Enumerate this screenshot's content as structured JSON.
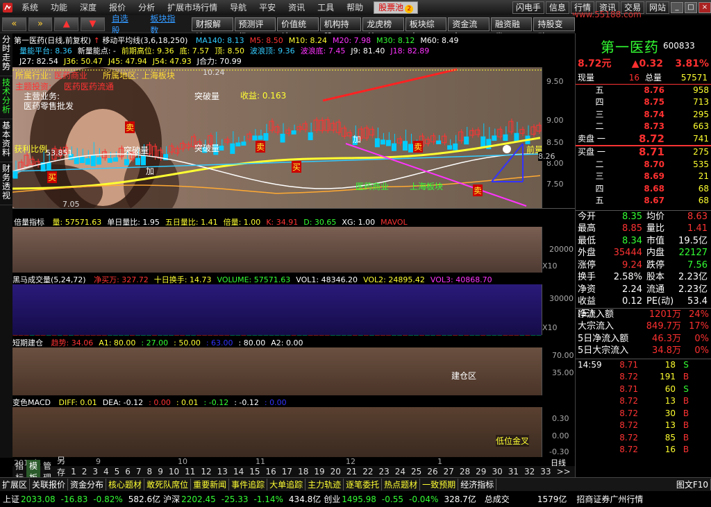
{
  "menu": {
    "items": [
      "系统",
      "功能",
      "深度",
      "报价",
      "分析",
      "扩展市场行情",
      "导航",
      "平安",
      "资讯",
      "工具",
      "帮助"
    ],
    "pool": "股票池",
    "right": [
      "闪电手",
      "信息",
      "行情",
      "资讯",
      "交易",
      "网站"
    ],
    "watermark": "www.55188.com"
  },
  "toolbar": {
    "links": [
      "自选股",
      "板块指数"
    ],
    "buttons": [
      "财报解读",
      "预测评级",
      "价值统计",
      "机构持股",
      "龙虎榜单",
      "板块综合",
      "资金流向",
      "融资融券",
      "持股变动"
    ]
  },
  "vtabs": [
    "分时走势",
    "技术分析",
    "基本资料",
    "财务透视"
  ],
  "main": {
    "title": "第一医药(日线,前复权)",
    "ma_title": "移动平均线(3,6,18,250)",
    "ma_vals": [
      {
        "t": "MA140: 8.13",
        "c": "#3cf"
      },
      {
        "t": "M5: 8.50",
        "c": "#f33"
      },
      {
        "t": "M10: 8.24",
        "c": "#ff3"
      },
      {
        "t": "M20: 7.98",
        "c": "#f3f"
      },
      {
        "t": "M30: 8.12",
        "c": "#3f3"
      },
      {
        "t": "M60: 8.49",
        "c": "#fff"
      }
    ],
    "l2": [
      {
        "t": "量能平台: 8.36",
        "c": "#3cf"
      },
      {
        "t": "新量能点: -",
        "c": "#fff"
      },
      {
        "t": "前期高位: 9.36",
        "c": "#ff3"
      },
      {
        "t": "底: 7.57",
        "c": "#ff3"
      },
      {
        "t": "顶: 8.50",
        "c": "#ff3"
      },
      {
        "t": "波浪顶: 9.36",
        "c": "#3cf"
      },
      {
        "t": "波浪底: 7.45",
        "c": "#f3f"
      },
      {
        "t": "J9: 81.40",
        "c": "#fff"
      },
      {
        "t": "J18: 82.89",
        "c": "#f3f"
      }
    ],
    "l3": [
      {
        "t": "J27: 82.54",
        "c": "#fff"
      },
      {
        "t": "J36: 50.47",
        "c": "#ff3"
      },
      {
        "t": "J45: 47.94",
        "c": "#ff3"
      },
      {
        "t": "J54: 47.93",
        "c": "#ff3"
      },
      {
        "t": "J合力: 70.99",
        "c": "#fff"
      }
    ],
    "overlay": {
      "gainian": "所属行业:",
      "hy": "医药商业",
      "region_label": "所属地区:",
      "region": "上海板块",
      "theme_label": "主题投资:",
      "theme": "医药医药流通",
      "business_label": "主营业务:",
      "business": "医药零售批发",
      "profit": "收益: 0.163",
      "ratio_label": "获利比例",
      "ratio_val": "53.851",
      "high": "10.24",
      "low": "7.05",
      "sector1": "医药商业",
      "sector2": "上海板块",
      "tupo": "突破量",
      "buy1": "买",
      "sell1": "卖",
      "add1": "加",
      "liangneng": "量能",
      "qianliang": "前量"
    },
    "price_ticks": [
      "9.50",
      "9.00",
      "8.50",
      "8.00",
      "7.50"
    ],
    "px_tick": "8.26",
    "vol_title": "倍量指标",
    "vol_vals": [
      {
        "t": "量: 57571.63",
        "c": "#ff3"
      },
      {
        "t": "单日量比: 1.95",
        "c": "#fff"
      },
      {
        "t": "五日量比: 1.41",
        "c": "#ff3"
      },
      {
        "t": "倍量: 1.00",
        "c": "#ff3"
      },
      {
        "t": "K: 34.91",
        "c": "#f33"
      },
      {
        "t": "D: 30.65",
        "c": "#3f3"
      },
      {
        "t": "XG: 1.00",
        "c": "#fff"
      },
      {
        "t": "MAVOL",
        "c": "#f33"
      }
    ],
    "vol_ticks": [
      "20000"
    ],
    "vol_unit": "X10",
    "hm_title": "黑马成交量(5,24,72)",
    "hm_vals": [
      {
        "t": "净买万: 327.72",
        "c": "#f33"
      },
      {
        "t": "十日换手: 14.73",
        "c": "#ff3"
      },
      {
        "t": "VOLUME: 57571.63",
        "c": "#3f3"
      },
      {
        "t": "VOL1: 48346.20",
        "c": "#fff"
      },
      {
        "t": "VOL2: 24895.42",
        "c": "#ff3"
      },
      {
        "t": "VOL3: 40868.70",
        "c": "#f3f"
      }
    ],
    "hm_ticks": [
      "30000"
    ],
    "hm_unit": "X10",
    "dq_title": "短期建仓",
    "dq_vals": [
      {
        "t": "趋势: 34.06",
        "c": "#f33"
      },
      {
        "t": "A1: 80.00",
        "c": "#ff3"
      },
      {
        "t": ": 27.00",
        "c": "#3f3"
      },
      {
        "t": ": 50.00",
        "c": "#ff3"
      },
      {
        "t": ": 63.00",
        "c": "#33f"
      },
      {
        "t": ": 80.00",
        "c": "#fff"
      },
      {
        "t": "A2: 0.00",
        "c": "#fff"
      }
    ],
    "dq_ticks": [
      "70.00",
      "35.00"
    ],
    "dq_label": "建仓区",
    "macd_title": "变色MACD",
    "macd_vals": [
      {
        "t": "DIFF: 0.01",
        "c": "#ff3"
      },
      {
        "t": "DEA: -0.12",
        "c": "#fff"
      },
      {
        "t": ": 0.00",
        "c": "#f33"
      },
      {
        "t": ": 0.01",
        "c": "#ff3"
      },
      {
        "t": ": -0.12",
        "c": "#3f3"
      },
      {
        "t": ": -0.12",
        "c": "#fff"
      },
      {
        "t": ": 0.00",
        "c": "#33f"
      }
    ],
    "macd_ticks": [
      "0.30",
      "0.00",
      "-0.30"
    ],
    "macd_label": "低位金叉",
    "xaxis": [
      "2013年",
      "9",
      "10",
      "11",
      "12",
      "1"
    ],
    "sidebar_bottom": "日线"
  },
  "bottomtabs": [
    "指标",
    "模板",
    "管理",
    "另存为",
    "1",
    "2",
    "3",
    "4",
    "5",
    "6",
    "7",
    "8",
    "9",
    "10",
    "11",
    "12",
    "13",
    "14",
    "15",
    "16",
    "17",
    "18",
    "19",
    "20",
    "21",
    "22",
    "23",
    "24",
    "25",
    "26",
    "27",
    "28",
    "29",
    "30",
    "31",
    "32",
    "33",
    ">>",
    "<<"
  ],
  "quote": {
    "name": "第一医药",
    "code": "600833",
    "price": "8.72元",
    "chg": "▲0.32",
    "pct": "3.81%",
    "xianliang_label": "现量",
    "xianliang": "16",
    "zongliang_label": "总量",
    "zongliang": "57571",
    "sells": [
      {
        "l": "五",
        "p": "8.76",
        "v": "958"
      },
      {
        "l": "四",
        "p": "8.75",
        "v": "713"
      },
      {
        "l": "三",
        "p": "8.74",
        "v": "295"
      },
      {
        "l": "二",
        "p": "8.73",
        "v": "663"
      },
      {
        "l": "卖盘 一",
        "p": "8.72",
        "v": "741"
      }
    ],
    "buys": [
      {
        "l": "买盘 一",
        "p": "8.71",
        "v": "275"
      },
      {
        "l": "二",
        "p": "8.70",
        "v": "535"
      },
      {
        "l": "三",
        "p": "8.69",
        "v": "21"
      },
      {
        "l": "四",
        "p": "8.68",
        "v": "68"
      },
      {
        "l": "五",
        "p": "8.67",
        "v": "68"
      }
    ],
    "stats": [
      {
        "a": "今开",
        "av": "8.35",
        "ac": "#3f3",
        "b": "均价",
        "bv": "8.63",
        "bc": "#f33"
      },
      {
        "a": "最高",
        "av": "8.85",
        "ac": "#f33",
        "b": "量比",
        "bv": "1.41",
        "bc": "#f33"
      },
      {
        "a": "最低",
        "av": "8.34",
        "ac": "#3f3",
        "b": "市值",
        "bv": "19.5亿",
        "bc": "#fff"
      },
      {
        "a": "外盘",
        "av": "35444",
        "ac": "#f33",
        "b": "内盘",
        "bv": "22127",
        "bc": "#3f3"
      },
      {
        "a": "涨停",
        "av": "9.24",
        "ac": "#f33",
        "b": "跌停",
        "bv": "7.56",
        "bc": "#3f3"
      },
      {
        "a": "换手",
        "av": "2.58%",
        "ac": "#fff",
        "b": "股本",
        "bv": "2.23亿",
        "bc": "#fff"
      },
      {
        "a": "净资",
        "av": "2.24",
        "ac": "#fff",
        "b": "流通",
        "bv": "2.23亿",
        "bc": "#fff"
      },
      {
        "a": "收益(三)",
        "av": "0.12",
        "ac": "#fff",
        "b": "PE(动)",
        "bv": "53.4",
        "bc": "#fff"
      }
    ],
    "flows": [
      {
        "l": "净流入额",
        "v": "1201万",
        "p": "24%"
      },
      {
        "l": "大宗流入",
        "v": "849.7万",
        "p": "17%"
      },
      {
        "l": "5日净流入额",
        "v": "46.3万",
        "p": "0%"
      },
      {
        "l": "5日大宗流入",
        "v": "34.8万",
        "p": "0%"
      }
    ],
    "ticks": [
      {
        "t": "14:59",
        "p": "8.71",
        "v": "18",
        "s": "S"
      },
      {
        "t": "",
        "p": "8.72",
        "v": "191",
        "s": "B"
      },
      {
        "t": "",
        "p": "8.71",
        "v": "60",
        "s": "S"
      },
      {
        "t": "",
        "p": "8.72",
        "v": "13",
        "s": "B"
      },
      {
        "t": "",
        "p": "8.72",
        "v": "30",
        "s": "B"
      },
      {
        "t": "",
        "p": "8.72",
        "v": "13",
        "s": "B"
      },
      {
        "t": "",
        "p": "8.72",
        "v": "85",
        "s": "B"
      },
      {
        "t": "",
        "p": "8.72",
        "v": "16",
        "s": "B"
      }
    ],
    "rtabs": [
      "笔",
      "价",
      "细",
      "盘",
      "势",
      "指",
      "值",
      "买"
    ]
  },
  "statusbar": {
    "items": [
      "扩展区",
      "关联报价",
      "资金分布",
      "核心题材",
      "敢死队席位",
      "重要新闻",
      "事件追踪",
      "大单追踪",
      "主力轨迹",
      "逐笔委托",
      "热点题材",
      "一致预期",
      "经济指标"
    ],
    "f10": "图文F10"
  },
  "ticker": [
    {
      "n": "上证",
      "p": "2033.08",
      "c": "-16.83",
      "pc": "-0.82%",
      "a": "582.6亿"
    },
    {
      "n": "沪深",
      "p": "2202.45",
      "c": "-25.33",
      "pc": "-1.14%",
      "a": "434.8亿"
    },
    {
      "n": "创业",
      "p": "1495.98",
      "c": "-0.55",
      "pc": "-0.04%",
      "a": "328.7亿"
    }
  ],
  "ticker_tail": {
    "label": "总成交",
    "val": "1579亿",
    "broker": "招商证券广州行情"
  },
  "colors": {
    "up": "#ff3030",
    "down": "#10e010",
    "accent": "#ffff30"
  }
}
